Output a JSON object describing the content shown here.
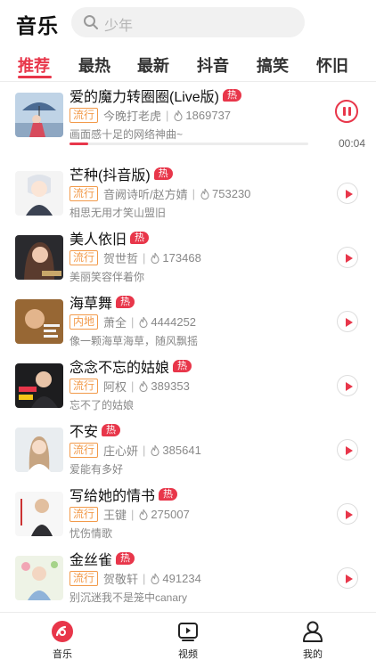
{
  "header": {
    "title": "音乐",
    "search_placeholder": "少年"
  },
  "tabs": [
    {
      "label": "推荐",
      "active": true
    },
    {
      "label": "最热",
      "active": false
    },
    {
      "label": "最新",
      "active": false
    },
    {
      "label": "抖音",
      "active": false
    },
    {
      "label": "搞笑",
      "active": false
    },
    {
      "label": "怀旧",
      "active": false
    }
  ],
  "now_playing": {
    "time": "00:04",
    "progress_fraction": 0.08
  },
  "songs": [
    {
      "title": "爱的魔力转圈圈(Live版)",
      "badge": "热",
      "genre": "流行",
      "artist": "今晚打老虎",
      "plays": "1869737",
      "desc": "画面感十足的网络神曲~",
      "state": "playing"
    },
    {
      "title": "芒种(抖音版)",
      "badge": "热",
      "genre": "流行",
      "artist": "音阙诗听/赵方婧",
      "plays": "753230",
      "desc": "相思无用才笑山盟旧",
      "state": "idle"
    },
    {
      "title": "美人依旧",
      "badge": "热",
      "genre": "流行",
      "artist": "贺世哲",
      "plays": "173468",
      "desc": "美丽笑容伴着你",
      "state": "idle"
    },
    {
      "title": "海草舞",
      "badge": "热",
      "genre": "内地",
      "artist": "萧全",
      "plays": "4444252",
      "desc": "像一颗海草海草，随风飘摇",
      "state": "idle"
    },
    {
      "title": "念念不忘的姑娘",
      "badge": "热",
      "genre": "流行",
      "artist": "阿权",
      "plays": "389353",
      "desc": "忘不了的姑娘",
      "state": "idle"
    },
    {
      "title": "不安",
      "badge": "热",
      "genre": "流行",
      "artist": "庄心妍",
      "plays": "385641",
      "desc": "爱能有多好",
      "state": "idle"
    },
    {
      "title": "写给她的情书",
      "badge": "热",
      "genre": "流行",
      "artist": "王键",
      "plays": "275007",
      "desc": "忧伤情歌",
      "state": "idle"
    },
    {
      "title": "金丝雀",
      "badge": "热",
      "genre": "流行",
      "artist": "贺敬轩",
      "plays": "491234",
      "desc": "别沉迷我不是笼中canary",
      "state": "idle"
    }
  ],
  "bottom_nav": [
    {
      "label": "音乐",
      "icon": "music-icon",
      "active": true
    },
    {
      "label": "视频",
      "icon": "video-icon",
      "active": false
    },
    {
      "label": "我的",
      "icon": "profile-icon",
      "active": false
    }
  ],
  "colors": {
    "accent": "#e8364a",
    "genre_tag": "#f29a4a"
  }
}
